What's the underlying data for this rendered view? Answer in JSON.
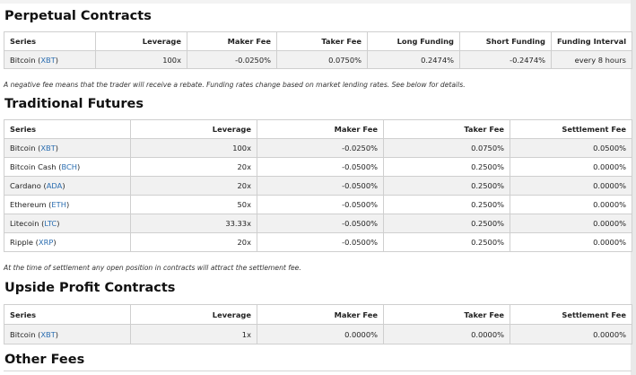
{
  "perpetual": {
    "title": "Perpetual Contracts",
    "headers": [
      "Series",
      "Leverage",
      "Maker Fee",
      "Taker Fee",
      "Long Funding",
      "Short Funding",
      "Funding Interval"
    ],
    "rows": [
      {
        "name": "Bitcoin",
        "symbol": "XBT",
        "values": [
          "100x",
          "-0.0250%",
          "0.0750%",
          "0.2474%",
          "-0.2474%",
          "every 8 hours"
        ]
      }
    ],
    "note": "A negative fee means that the trader will receive a rebate. Funding rates change based on market lending rates. See below for details."
  },
  "traditional": {
    "title": "Traditional Futures",
    "headers": [
      "Series",
      "Leverage",
      "Maker Fee",
      "Taker Fee",
      "Settlement Fee"
    ],
    "rows": [
      {
        "name": "Bitcoin",
        "symbol": "XBT",
        "values": [
          "100x",
          "-0.0250%",
          "0.0750%",
          "0.0500%"
        ]
      },
      {
        "name": "Bitcoin Cash",
        "symbol": "BCH",
        "values": [
          "20x",
          "-0.0500%",
          "0.2500%",
          "0.0000%"
        ]
      },
      {
        "name": "Cardano",
        "symbol": "ADA",
        "values": [
          "20x",
          "-0.0500%",
          "0.2500%",
          "0.0000%"
        ]
      },
      {
        "name": "Ethereum",
        "symbol": "ETH",
        "values": [
          "50x",
          "-0.0500%",
          "0.2500%",
          "0.0000%"
        ]
      },
      {
        "name": "Litecoin",
        "symbol": "LTC",
        "values": [
          "33.33x",
          "-0.0500%",
          "0.2500%",
          "0.0000%"
        ]
      },
      {
        "name": "Ripple",
        "symbol": "XRP",
        "values": [
          "20x",
          "-0.0500%",
          "0.2500%",
          "0.0000%"
        ]
      }
    ],
    "note": "At the time of settlement any open position in contracts will attract the settlement fee."
  },
  "upside": {
    "title": "Upside Profit Contracts",
    "headers": [
      "Series",
      "Leverage",
      "Maker Fee",
      "Taker Fee",
      "Settlement Fee"
    ],
    "rows": [
      {
        "name": "Bitcoin",
        "symbol": "XBT",
        "values": [
          "1x",
          "0.0000%",
          "0.0000%",
          "0.0000%"
        ]
      }
    ]
  },
  "other": {
    "title": "Other Fees"
  },
  "colors": {
    "link": "#2a6db0",
    "row_shaded": "#f1f1f1",
    "border": "#cfcfcf"
  }
}
